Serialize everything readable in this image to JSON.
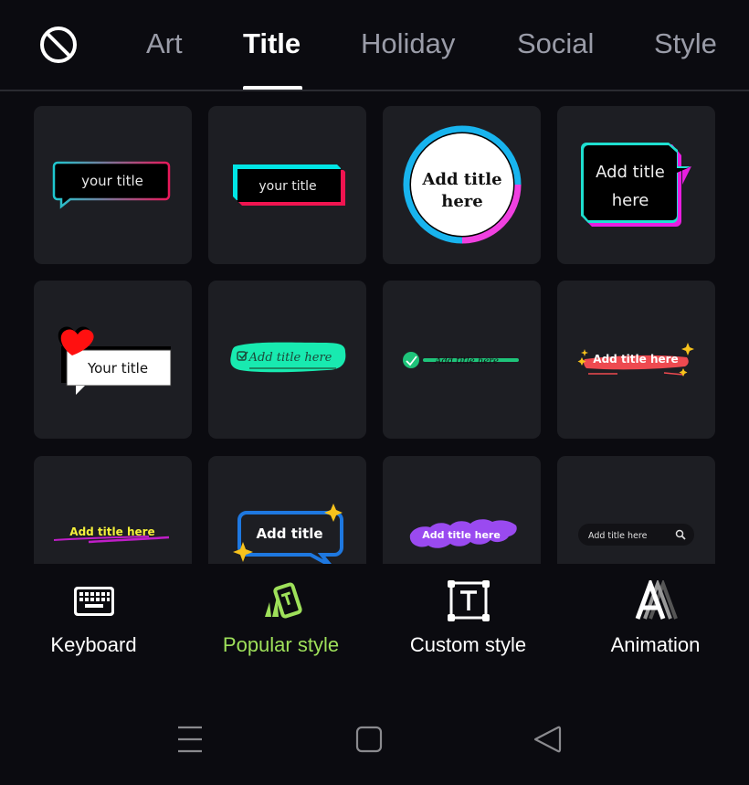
{
  "top_bar": {
    "none_icon": "no-style-icon",
    "tabs": [
      {
        "label": "Art",
        "active": false
      },
      {
        "label": "Title",
        "active": true
      },
      {
        "label": "Holiday",
        "active": false
      },
      {
        "label": "Social",
        "active": false
      },
      {
        "label": "Style",
        "active": false
      }
    ]
  },
  "templates": [
    {
      "text": "your title",
      "style": "gradient-speech-bubble",
      "colors": [
        "#1ec8d0",
        "#e8185a"
      ]
    },
    {
      "text": "your title",
      "style": "cyan-red-offset-box",
      "colors": [
        "#00e5e5",
        "#f01450"
      ]
    },
    {
      "text_line1": "Add title",
      "text_line2": "here",
      "style": "circle-badge",
      "colors": [
        "#18b4ee",
        "#f040e0"
      ]
    },
    {
      "text_line1": "Add title",
      "text_line2": "here",
      "style": "neon-speech-box",
      "colors": [
        "#1ee0d0",
        "#e81ee0"
      ]
    },
    {
      "text": "Your title",
      "style": "heart-speech-bubble",
      "colors": [
        "#ff1010",
        "#ffffff"
      ]
    },
    {
      "text": "Add title here",
      "style": "green-brush-check",
      "colors": [
        "#18eab0",
        "#1a6a4a"
      ]
    },
    {
      "text": "Add title here",
      "style": "green-check-strike",
      "colors": [
        "#1ec47a"
      ]
    },
    {
      "text": "Add title here",
      "style": "red-brush-sparkle",
      "colors": [
        "#ee4a50",
        "#f7c21c"
      ]
    },
    {
      "text": "Add title here",
      "style": "yellow-magenta-scribble",
      "colors": [
        "#f4f03a",
        "#c01ec8"
      ]
    },
    {
      "text": "Add title",
      "style": "blue-bubble-stars",
      "colors": [
        "#1e78e0",
        "#f7c21c"
      ]
    },
    {
      "text": "Add title here",
      "style": "purple-cloud",
      "colors": [
        "#9a4af0"
      ]
    },
    {
      "text": "Add title here",
      "style": "search-bar",
      "colors": [
        "#121216"
      ]
    }
  ],
  "bottom_tools": [
    {
      "label": "Keyboard",
      "icon": "keyboard-icon",
      "active": false
    },
    {
      "label": "Popular style",
      "icon": "popular-style-icon",
      "active": true
    },
    {
      "label": "Custom style",
      "icon": "custom-style-icon",
      "active": false
    },
    {
      "label": "Animation",
      "icon": "animation-icon",
      "active": false
    }
  ],
  "nav_bar": {
    "menu_icon": "recent-apps-icon",
    "home_icon": "home-icon",
    "back_icon": "back-icon"
  },
  "colors": {
    "background": "#0b0b10",
    "tile": "#1d1e23",
    "tab_inactive": "#9a9ca8",
    "accent_green": "#9ee05a"
  }
}
